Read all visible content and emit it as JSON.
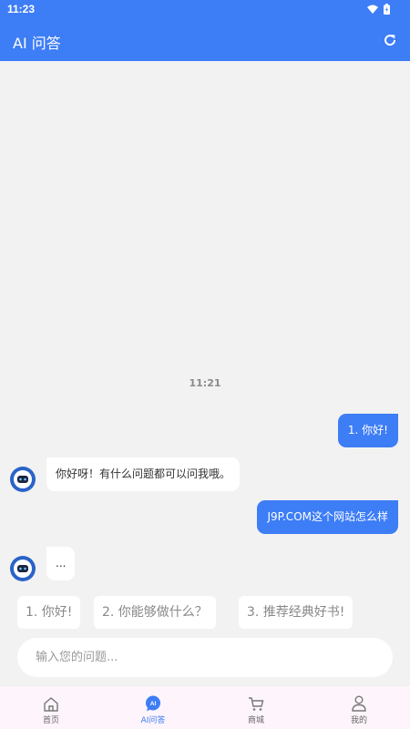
{
  "status_bar": {
    "time": "11:23"
  },
  "app_bar": {
    "title": "AI 问答"
  },
  "chat": {
    "timestamp": "11:21",
    "messages": [
      {
        "role": "user",
        "text": "1. 你好!"
      },
      {
        "role": "bot",
        "text": "你好呀！有什么问题都可以问我哦。"
      },
      {
        "role": "user",
        "text": "J9P.COM这个网站怎么样"
      },
      {
        "role": "bot",
        "text": "..."
      }
    ]
  },
  "suggestions": [
    "1. 你好!",
    "2. 你能够做什么？",
    "3. 推荐经典好书!"
  ],
  "input": {
    "placeholder": "输入您的问题..."
  },
  "tabbar": {
    "items": [
      {
        "label": "首页",
        "icon": "home-icon"
      },
      {
        "label": "AI问答",
        "icon": "ai-chat-icon",
        "active": true
      },
      {
        "label": "商城",
        "icon": "cart-icon"
      },
      {
        "label": "我的",
        "icon": "user-icon"
      }
    ]
  },
  "colors": {
    "primary": "#3d7df6",
    "background": "#f2f2f2"
  }
}
